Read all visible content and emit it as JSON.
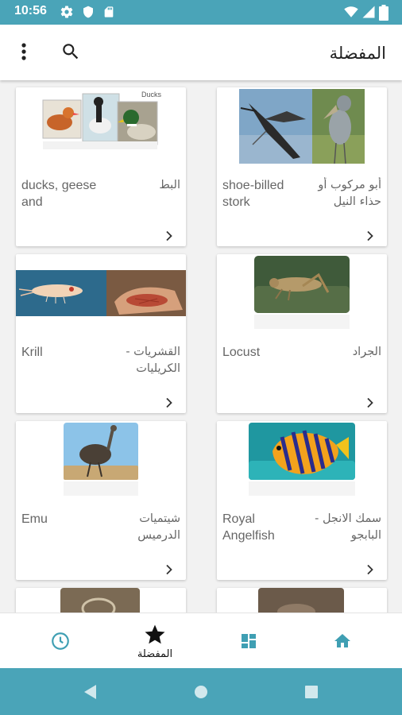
{
  "status_bar": {
    "time": "10:56"
  },
  "app_bar": {
    "title": "المفضلة"
  },
  "cards": [
    {
      "en": "shoe-billed stork",
      "ar": "أبو مركوب أو حذاء النيل"
    },
    {
      "en": "ducks, geese and",
      "ar": "البط"
    },
    {
      "en": "Locust",
      "ar": "الجراد"
    },
    {
      "en": "Krill",
      "ar": "القشريات - الكريليات"
    },
    {
      "en": "Royal Angelfish",
      "ar": "سمك الانجل - البابجو"
    },
    {
      "en": "Emu",
      "ar": "شيتميات الدرميس"
    }
  ],
  "ducks_caption": "Ducks",
  "bottom_nav": {
    "favorites_label": "المفضلة"
  },
  "colors": {
    "accent": "#4aa4b8",
    "icon_teal": "#3f9fb3"
  }
}
